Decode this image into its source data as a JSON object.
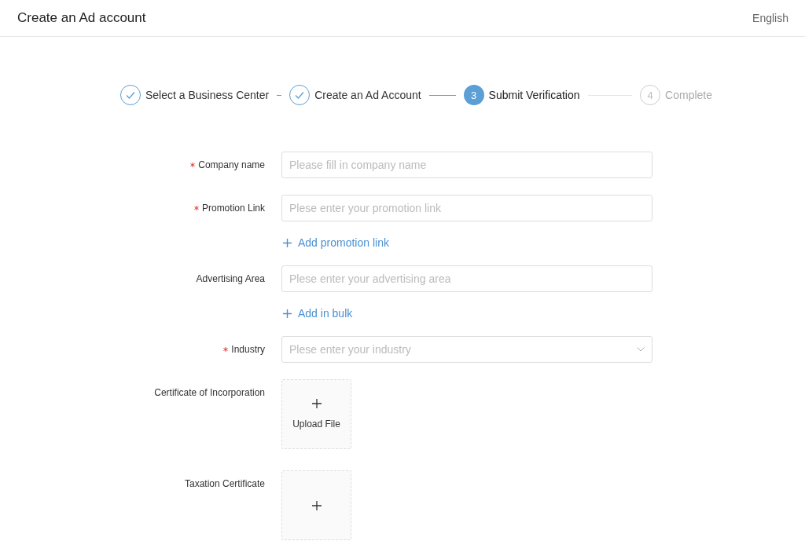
{
  "header": {
    "title": "Create an Ad account",
    "language": "English"
  },
  "steps": [
    {
      "label": "Select a Business Center",
      "done": true,
      "current": false
    },
    {
      "label": "Create an Ad Account",
      "done": true,
      "current": false
    },
    {
      "label": "Submit Verification",
      "done": false,
      "current": true,
      "number": "3"
    },
    {
      "label": "Complete",
      "done": false,
      "current": false,
      "number": "4"
    }
  ],
  "form": [
    {
      "kind": "input",
      "label": "Company name",
      "required": true,
      "placeholder": "Please fill in company name"
    },
    {
      "kind": "input",
      "label": "Promotion Link",
      "required": true,
      "placeholder": "Plese enter your promotion link"
    },
    {
      "kind": "link",
      "text": "Add promotion link"
    },
    {
      "kind": "input",
      "label": "Advertising Area",
      "required": false,
      "placeholder": "Plese enter your advertising area"
    },
    {
      "kind": "link",
      "text": "Add in bulk"
    },
    {
      "kind": "select",
      "label": "Industry",
      "required": true,
      "placeholder": "Plese enter your industry"
    },
    {
      "kind": "upload",
      "label": "Certificate of Incorporation",
      "required": false,
      "button": "Upload File"
    },
    {
      "kind": "upload",
      "label": "Taxation Certificate",
      "required": false
    }
  ]
}
